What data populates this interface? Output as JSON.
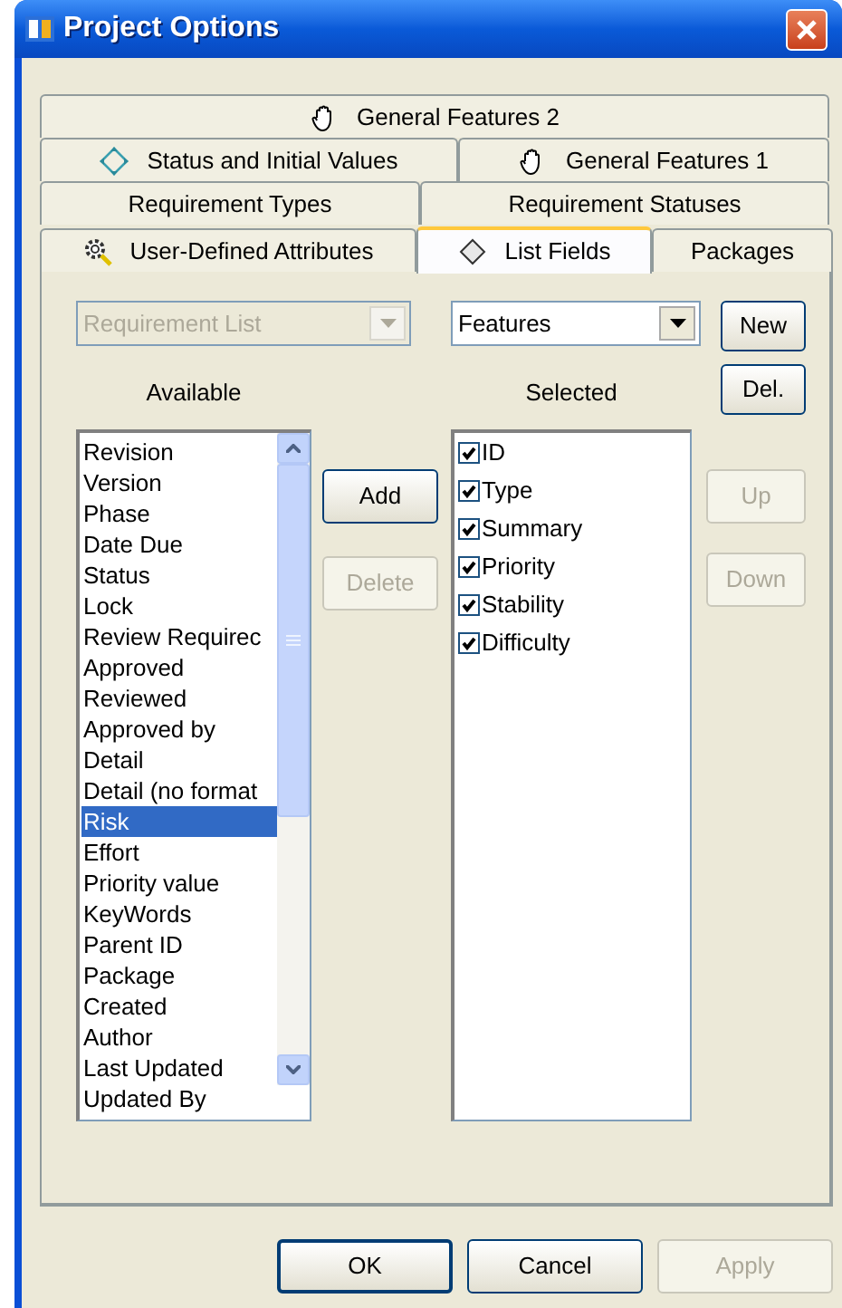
{
  "window": {
    "title": "Project Options"
  },
  "tab_rows": [
    [
      {
        "label": "General Features 2",
        "kind": "hand",
        "selected": false
      }
    ],
    [
      {
        "label": "Status and Initial Values",
        "kind": "compass",
        "selected": false
      },
      {
        "label": "General Features 1",
        "kind": "hand",
        "selected": false
      }
    ],
    [
      {
        "label": "Requirement Types",
        "kind": "plain",
        "selected": false
      },
      {
        "label": "Requirement Statuses",
        "kind": "plain",
        "selected": false
      }
    ],
    [
      {
        "label": "User-Defined Attributes",
        "kind": "gear",
        "selected": false
      },
      {
        "label": "List Fields",
        "kind": "diamond",
        "selected": true
      },
      {
        "label": "Packages",
        "kind": "plain",
        "selected": false
      }
    ]
  ],
  "list_type": {
    "value": "Requirement List",
    "disabled": true
  },
  "list_name": {
    "value": "Features",
    "disabled": false
  },
  "new_button": {
    "label": "New",
    "disabled": false
  },
  "del_button": {
    "label": "Del.",
    "disabled": false
  },
  "available": {
    "label": "Available",
    "items": [
      {
        "label": "Revision",
        "selected": false
      },
      {
        "label": "Version",
        "selected": false
      },
      {
        "label": "Phase",
        "selected": false
      },
      {
        "label": "Date Due",
        "selected": false
      },
      {
        "label": "Status",
        "selected": false
      },
      {
        "label": "Lock",
        "selected": false
      },
      {
        "label": "Review Requirec",
        "selected": false
      },
      {
        "label": "Approved",
        "selected": false
      },
      {
        "label": "Reviewed",
        "selected": false
      },
      {
        "label": "Approved by",
        "selected": false
      },
      {
        "label": "Detail",
        "selected": false
      },
      {
        "label": "Detail (no format",
        "selected": false
      },
      {
        "label": "Risk",
        "selected": true
      },
      {
        "label": "Effort",
        "selected": false
      },
      {
        "label": "Priority value",
        "selected": false
      },
      {
        "label": "KeyWords",
        "selected": false
      },
      {
        "label": "Parent ID",
        "selected": false
      },
      {
        "label": "Package",
        "selected": false
      },
      {
        "label": "Created",
        "selected": false
      },
      {
        "label": "Author",
        "selected": false
      },
      {
        "label": "Last Updated",
        "selected": false
      },
      {
        "label": "Updated By",
        "selected": false
      }
    ]
  },
  "add_button": {
    "label": "Add",
    "disabled": false
  },
  "delete_button": {
    "label": "Delete",
    "disabled": true
  },
  "selected": {
    "label": "Selected",
    "items": [
      {
        "label": "ID",
        "checked": true
      },
      {
        "label": "Type",
        "checked": true
      },
      {
        "label": "Summary",
        "checked": true
      },
      {
        "label": "Priority",
        "checked": true
      },
      {
        "label": "Stability",
        "checked": true
      },
      {
        "label": "Difficulty",
        "checked": true
      }
    ]
  },
  "up_button": {
    "label": "Up",
    "disabled": true
  },
  "down_button": {
    "label": "Down",
    "disabled": true
  },
  "footer_buttons": [
    {
      "label": "OK",
      "disabled": false,
      "default": true
    },
    {
      "label": "Cancel",
      "disabled": false,
      "default": false
    },
    {
      "label": "Apply",
      "disabled": true,
      "default": false
    }
  ]
}
